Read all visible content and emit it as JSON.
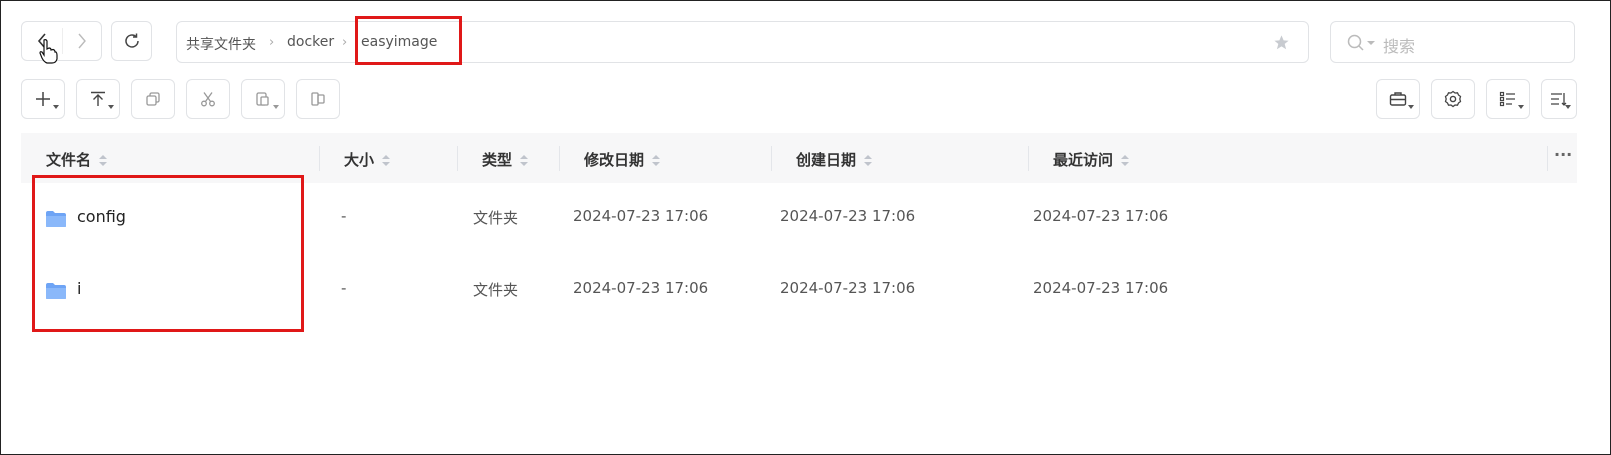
{
  "toolbar": {
    "back_icon": "chevron-left-icon",
    "forward_icon": "chevron-right-icon",
    "refresh_icon": "refresh-icon",
    "actions": [
      "new-icon",
      "upload-icon",
      "copy-icon",
      "cut-icon",
      "paste-icon",
      "copy-to-icon"
    ],
    "right_actions": [
      "toolbox-icon",
      "settings-icon",
      "list-view-icon",
      "sort-icon"
    ]
  },
  "breadcrumb": {
    "items": [
      "共享文件夹",
      "docker",
      "easyimage"
    ]
  },
  "search": {
    "placeholder": "搜索"
  },
  "table": {
    "columns": [
      "文件名",
      "大小",
      "类型",
      "修改日期",
      "创建日期",
      "最近访问"
    ],
    "more_label": "···",
    "rows": [
      {
        "name": "config",
        "size": "-",
        "type": "文件夹",
        "modified": "2024-07-23 17:06",
        "created": "2024-07-23 17:06",
        "accessed": "2024-07-23 17:06"
      },
      {
        "name": "i",
        "size": "-",
        "type": "文件夹",
        "modified": "2024-07-23 17:06",
        "created": "2024-07-23 17:06",
        "accessed": "2024-07-23 17:06"
      }
    ]
  },
  "colors": {
    "highlight": "#e01818",
    "folder": "#6ea4f5",
    "header_bg": "#f7f7f8"
  }
}
